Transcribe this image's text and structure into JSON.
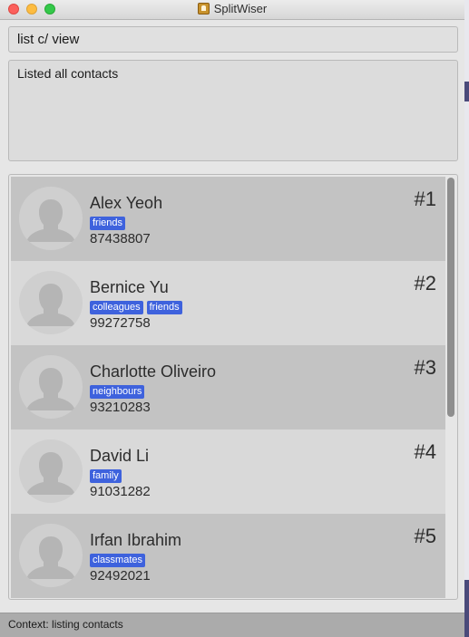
{
  "window": {
    "title": "SplitWiser"
  },
  "command": {
    "value": "list c/ view"
  },
  "result": {
    "text": "Listed all contacts"
  },
  "contacts": [
    {
      "index": "#1",
      "name": "Alex Yeoh",
      "tags": [
        "friends"
      ],
      "phone": "87438807"
    },
    {
      "index": "#2",
      "name": "Bernice Yu",
      "tags": [
        "colleagues",
        "friends"
      ],
      "phone": "99272758"
    },
    {
      "index": "#3",
      "name": "Charlotte Oliveiro",
      "tags": [
        "neighbours"
      ],
      "phone": "93210283"
    },
    {
      "index": "#4",
      "name": "David Li",
      "tags": [
        "family"
      ],
      "phone": "91031282"
    },
    {
      "index": "#5",
      "name": "Irfan Ibrahim",
      "tags": [
        "classmates"
      ],
      "phone": "92492021"
    }
  ],
  "status": {
    "text": "Context: listing contacts"
  },
  "colors": {
    "tag": "#3e62dd",
    "card_dark": "#c3c3c3",
    "card_light": "#d9d9d9"
  }
}
